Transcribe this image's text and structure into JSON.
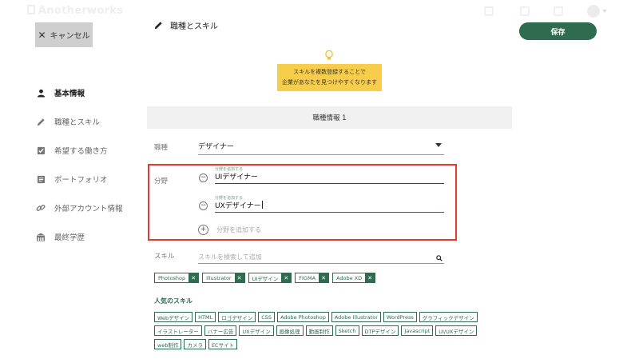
{
  "app": {
    "logo": "Anotherworks"
  },
  "header": {
    "cancel_label": "キャンセル",
    "save_label": "保存",
    "page_title": "職種とスキル"
  },
  "sidebar": {
    "items": [
      {
        "label": "基本情報",
        "icon": "person-icon",
        "active": true
      },
      {
        "label": "職種とスキル",
        "icon": "pencil-icon",
        "active": false
      },
      {
        "label": "希望する働き方",
        "icon": "checkbox-icon",
        "active": false
      },
      {
        "label": "ポートフォリオ",
        "icon": "document-icon",
        "active": false
      },
      {
        "label": "外部アカウント情報",
        "icon": "link-icon",
        "active": false
      },
      {
        "label": "最終学歴",
        "icon": "school-icon",
        "active": false
      }
    ]
  },
  "tip": {
    "line1": "スキルを複数登録することで",
    "line2": "企業があなたを見つけやすくなります"
  },
  "section": {
    "title": "職種情報 1"
  },
  "job": {
    "label": "職種",
    "value": "デザイナー"
  },
  "fields": {
    "label": "分野",
    "entries": [
      {
        "caption": "分野を追加する",
        "value": "UIデザイナー"
      },
      {
        "caption": "分野を追加する",
        "value": "UXデザイナー"
      }
    ],
    "add_label": "分野を追加する"
  },
  "skills": {
    "label": "スキル",
    "search_placeholder": "スキルを検索して追加",
    "selected": [
      "Photoshop",
      "Illustrator",
      "UIデザイン",
      "FIGMA",
      "Adobe XD"
    ]
  },
  "popular": {
    "title": "人気のスキル",
    "items": [
      "Webデザイン",
      "HTML",
      "ロゴデザイン",
      "CSS",
      "Adobe Photoshop",
      "Adobe Illustrator",
      "WordPress",
      "グラフィックデザイン",
      "イラストレーター",
      "バナー広告",
      "UXデザイン",
      "画像処理",
      "動画制作",
      "Sketch",
      "DTPデザイン",
      "Javascript",
      "UI/UXデザイン",
      "web制作",
      "カメラ",
      "ECサイト"
    ]
  },
  "colors": {
    "accent": "#2e6b4f",
    "tip_bg": "#f7cd4b",
    "highlight": "#e53b2c"
  }
}
